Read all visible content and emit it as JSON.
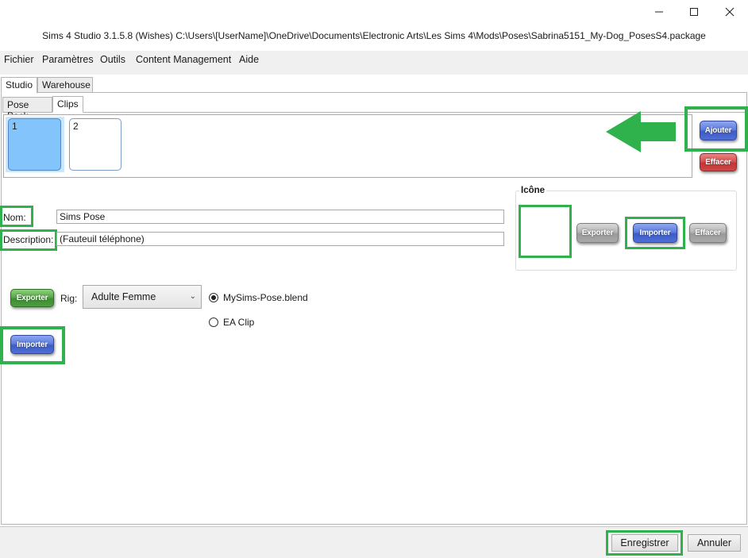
{
  "window": {
    "title": "Sims 4 Studio 3.1.5.8 (Wishes)  C:\\Users\\[UserName]\\OneDrive\\Documents\\Electronic Arts\\Les Sims 4\\Mods\\Poses\\Sabrina5151_My-Dog_PosesS4.package"
  },
  "menu": {
    "items": [
      "Fichier",
      "Paramètres",
      "Outils",
      "Content Management",
      "Aide"
    ]
  },
  "main_tabs": [
    "Studio",
    "Warehouse"
  ],
  "sub_tabs": [
    "Pose Pack",
    "Clips"
  ],
  "clips": {
    "items": [
      "1",
      "2"
    ],
    "add_label": "Ajouter",
    "delete_label": "Effacer"
  },
  "form": {
    "name_label": "Nom:",
    "name_value": "Sims Pose",
    "description_label": "Description:",
    "description_value": "(Fauteuil téléphone)"
  },
  "icon_group": {
    "title": "Icône",
    "export_label": "Exporter",
    "import_label": "Importer",
    "delete_label": "Effacer"
  },
  "animation": {
    "export_label": "Exporter",
    "rig_label": "Rig:",
    "rig_selected": "Adulte Femme",
    "options": [
      "MySims-Pose.blend",
      "EA Clip"
    ],
    "selected_option": 0,
    "import_label": "Importer"
  },
  "footer": {
    "save_label": "Enregistrer",
    "cancel_label": "Annuler"
  },
  "colors": {
    "highlight": "#2fb14b",
    "selected_clip": "#82c4fb",
    "blue_button": "#4f6fd6",
    "red_button": "#cf4747"
  }
}
